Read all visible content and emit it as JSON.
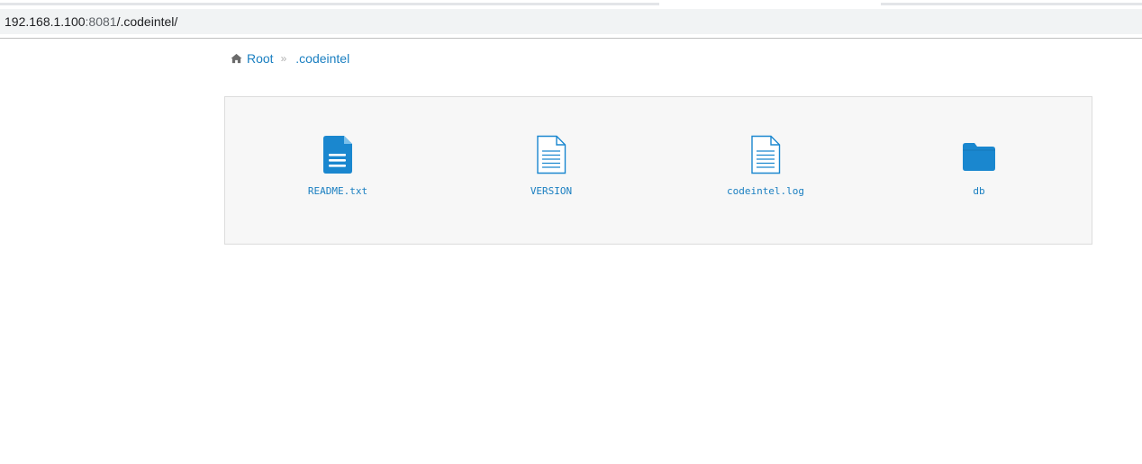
{
  "browser": {
    "url_host": "192.168.1.100",
    "url_port": ":8081",
    "url_path": "/.codeintel/"
  },
  "breadcrumb": {
    "home_icon": "home-icon",
    "root_label": "Root",
    "separator": "»",
    "current_label": ".codeintel"
  },
  "files": [
    {
      "name": "README.txt",
      "icon": "document-filled-icon"
    },
    {
      "name": "VERSION",
      "icon": "document-outline-icon"
    },
    {
      "name": "codeintel.log",
      "icon": "document-outline-icon"
    },
    {
      "name": "db",
      "icon": "folder-icon"
    }
  ],
  "colors": {
    "link": "#1a7fc1",
    "icon": "#1a87cf",
    "panel_bg": "#f7f7f7"
  }
}
